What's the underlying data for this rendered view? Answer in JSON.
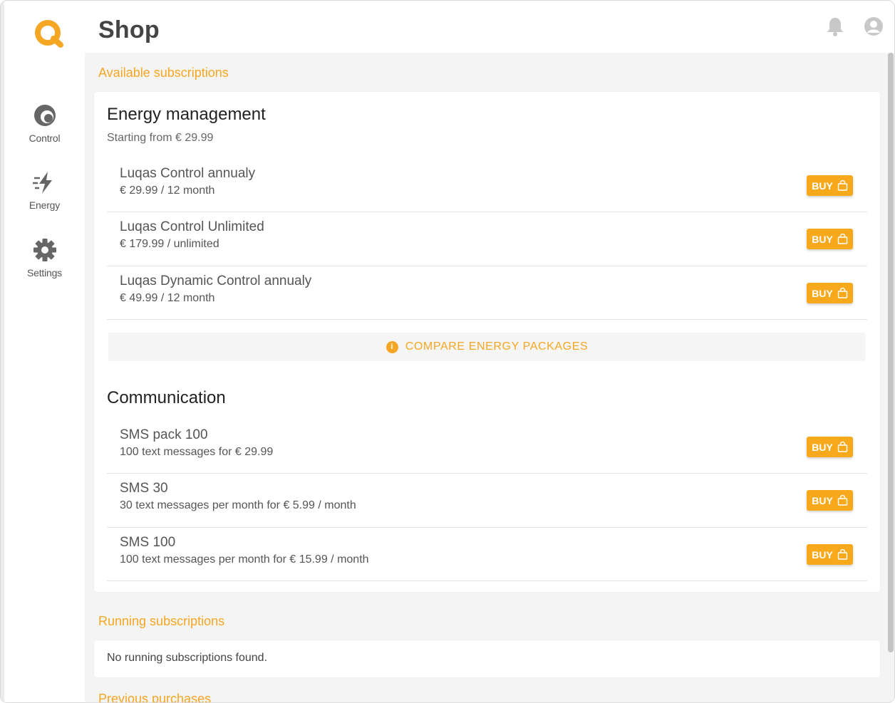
{
  "colors": {
    "accent": "#f5a623",
    "buy": "#f7a81b"
  },
  "sidebar": {
    "items": [
      {
        "label": "Control",
        "icon": "control-icon"
      },
      {
        "label": "Energy",
        "icon": "energy-icon"
      },
      {
        "label": "Settings",
        "icon": "gear-icon"
      }
    ]
  },
  "header": {
    "title": "Shop"
  },
  "available": {
    "label": "Available subscriptions",
    "energy": {
      "title": "Energy management",
      "subtitle": "Starting from € 29.99",
      "items": [
        {
          "name": "Luqas Control annualy",
          "price": "€ 29.99 / 12 month",
          "button": "BUY"
        },
        {
          "name": "Luqas Control Unlimited",
          "price": "€ 179.99 / unlimited",
          "button": "BUY"
        },
        {
          "name": "Luqas Dynamic Control annualy",
          "price": "€ 49.99 / 12 month",
          "button": "BUY"
        }
      ],
      "compare_label": "COMPARE ENERGY PACKAGES"
    },
    "communication": {
      "title": "Communication",
      "items": [
        {
          "name": "SMS pack 100",
          "price": "100 text messages for € 29.99",
          "button": "BUY"
        },
        {
          "name": "SMS 30",
          "price": "30 text messages per month for € 5.99 / month",
          "button": "BUY"
        },
        {
          "name": "SMS 100",
          "price": "100 text messages per month for € 15.99 / month",
          "button": "BUY"
        }
      ]
    }
  },
  "running": {
    "label": "Running subscriptions",
    "empty": "No running subscriptions found."
  },
  "previous": {
    "label": "Previous purchases"
  }
}
